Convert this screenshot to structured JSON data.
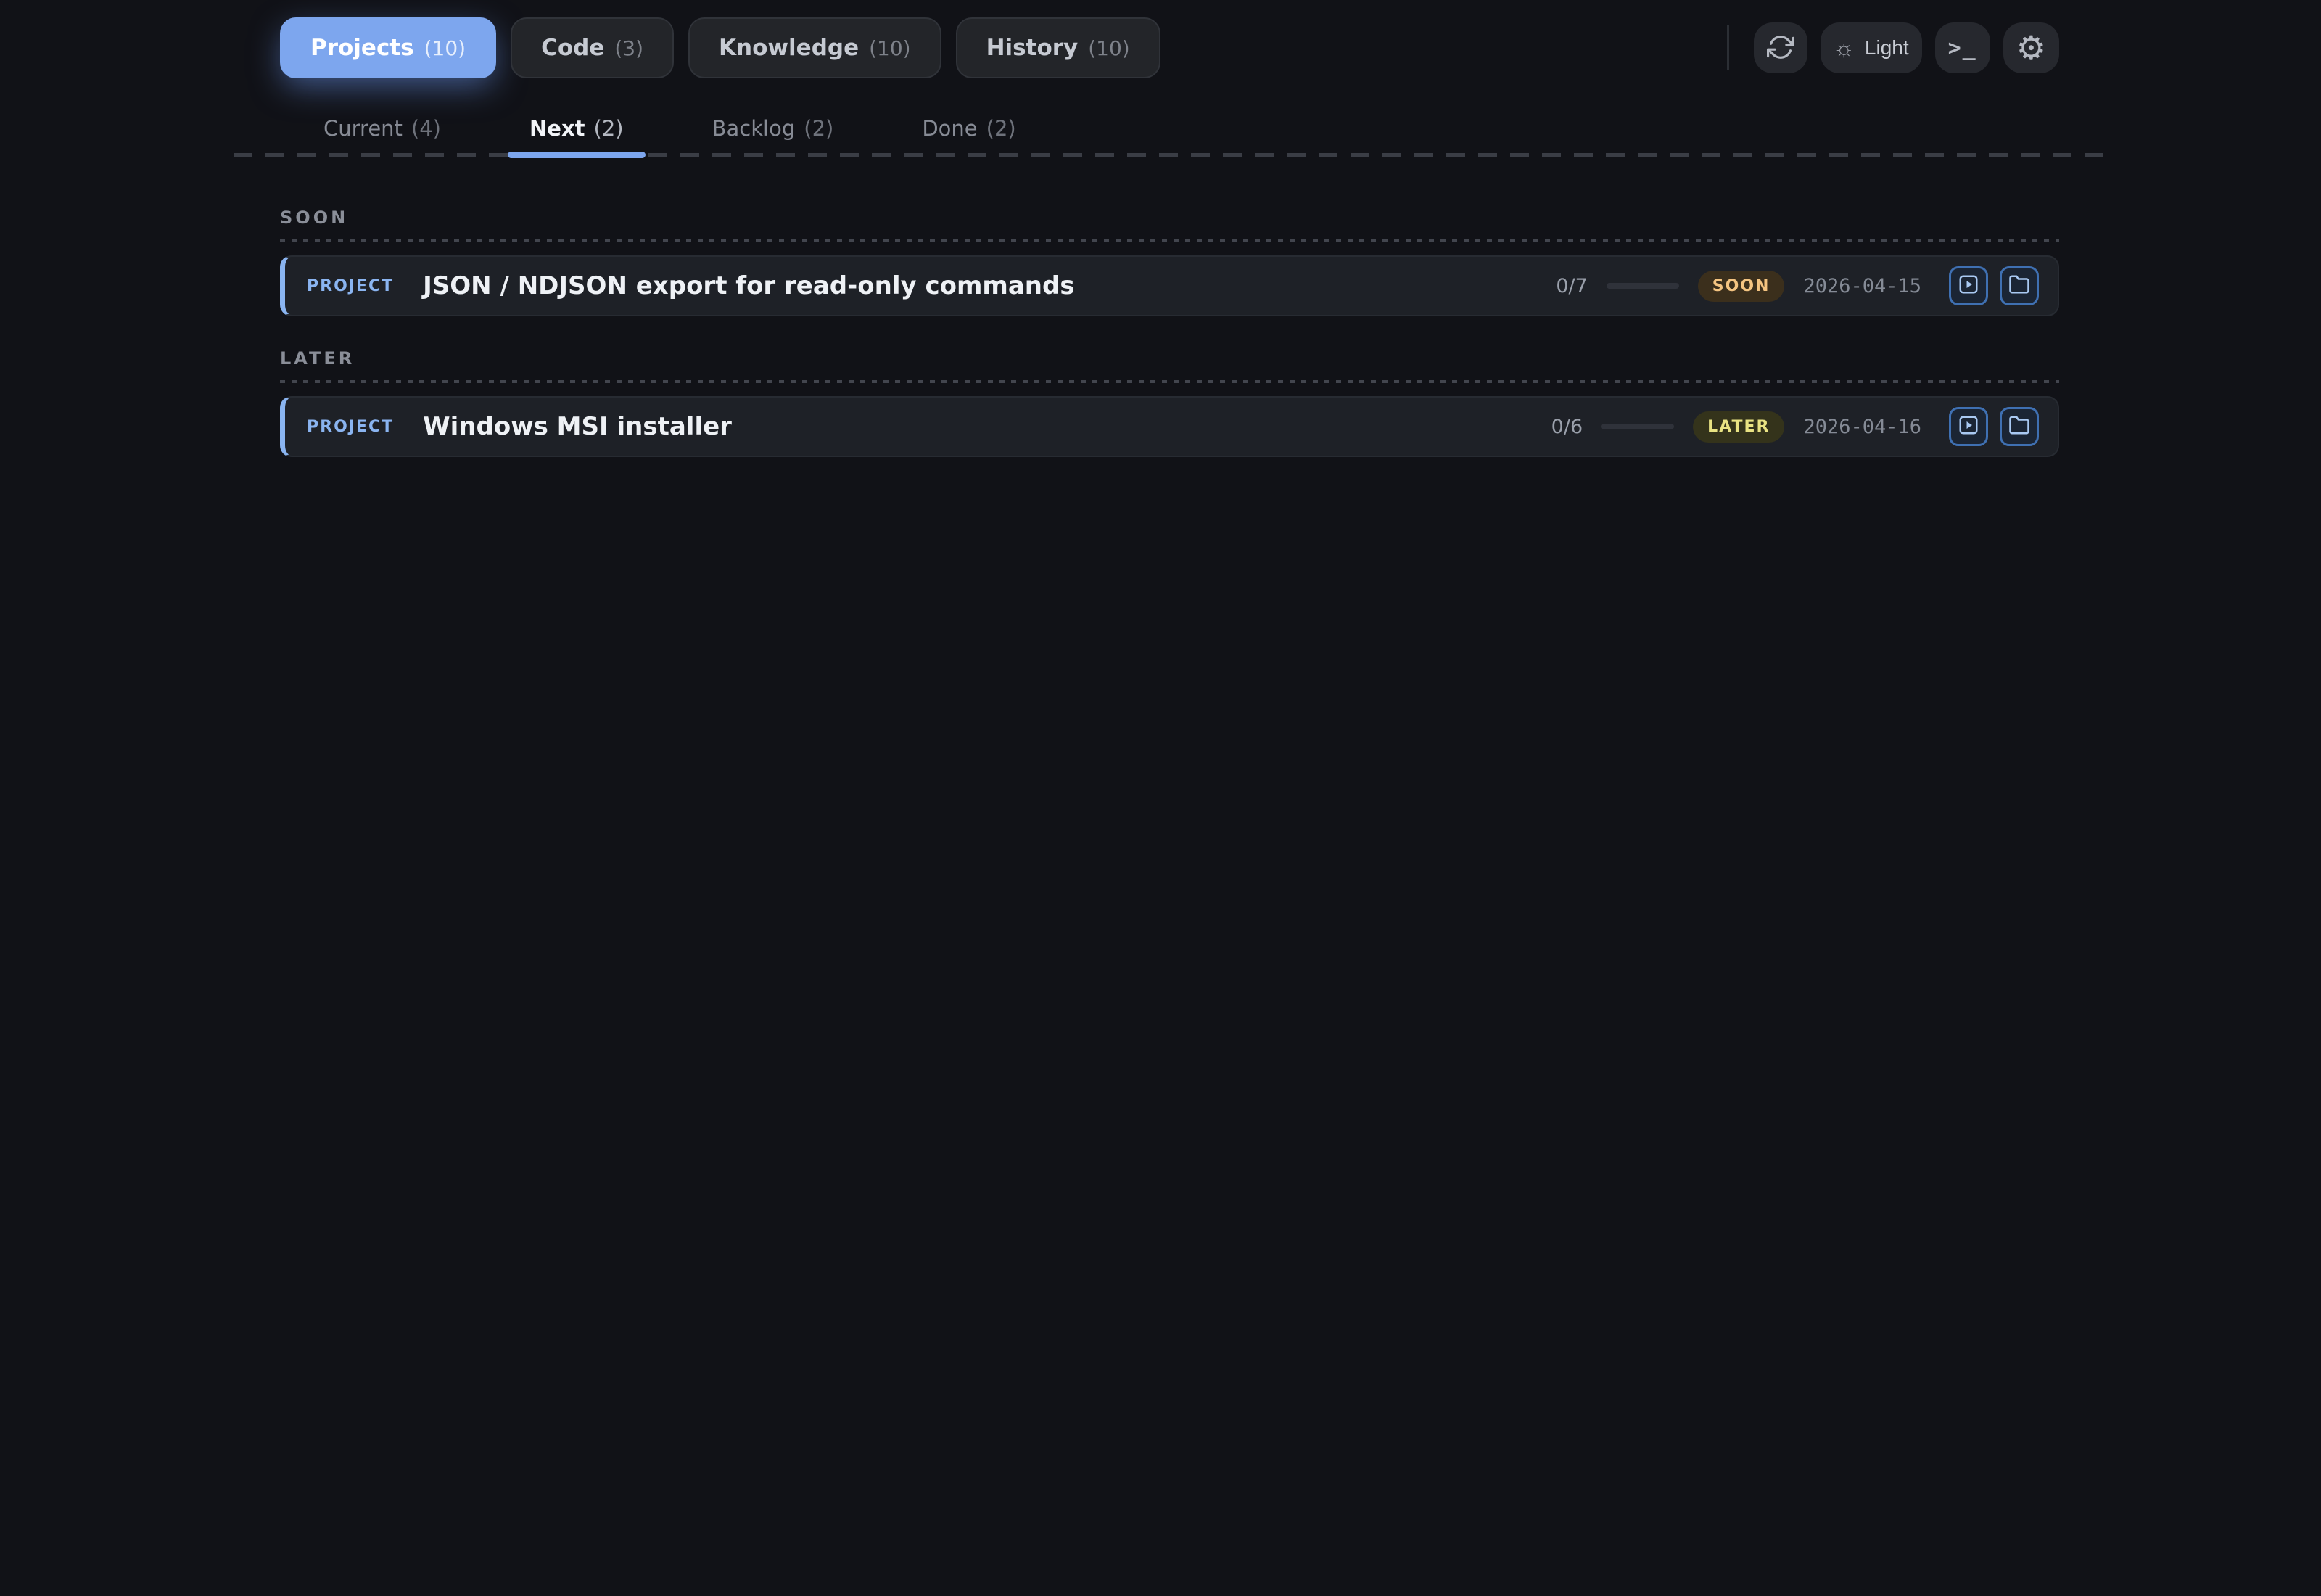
{
  "header": {
    "tabs": [
      {
        "label": "Projects",
        "count": "(10)"
      },
      {
        "label": "Code",
        "count": "(3)"
      },
      {
        "label": "Knowledge",
        "count": "(10)"
      },
      {
        "label": "History",
        "count": "(10)"
      }
    ],
    "controls": {
      "theme_label": "Light",
      "sun_glyph": "☼",
      "terminal_glyph": ">_",
      "gear_glyph": "⚙"
    }
  },
  "subtabs": [
    {
      "label": "Current",
      "count": "(4)"
    },
    {
      "label": "Next",
      "count": "(2)"
    },
    {
      "label": "Backlog",
      "count": "(2)"
    },
    {
      "label": "Done",
      "count": "(2)"
    }
  ],
  "sections": [
    {
      "heading": "SOON",
      "card": {
        "type_label": "PROJECT",
        "title": "JSON / NDJSON export for read-only commands",
        "progress": "0/7",
        "badge": "SOON",
        "date": "2026-04-15"
      }
    },
    {
      "heading": "LATER",
      "card": {
        "type_label": "PROJECT",
        "title": "Windows MSI installer",
        "progress": "0/6",
        "badge": "LATER",
        "date": "2026-04-16"
      }
    }
  ],
  "colors": {
    "accent_blue": "#7da6ee",
    "card_accent": "#8ab4f0",
    "badge_soon_fg": "#f4c481",
    "badge_later_fg": "#e9e383",
    "page_bg": "#111217",
    "card_bg": "#1e2127"
  }
}
